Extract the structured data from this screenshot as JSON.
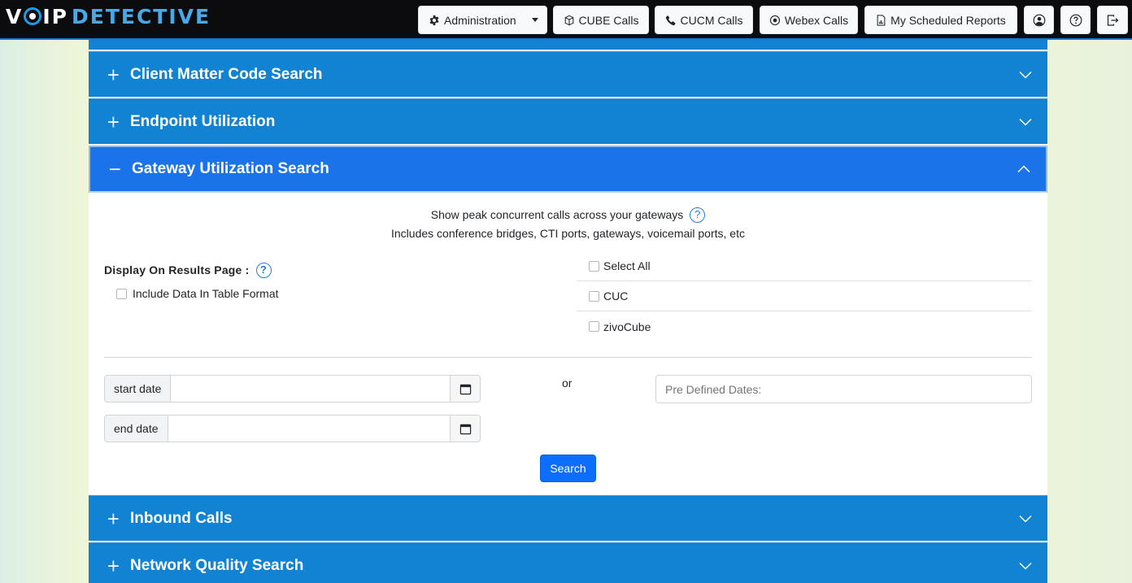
{
  "brand": {
    "part1": "V",
    "part2": "IP",
    "part3": "DETECTIVE"
  },
  "nav": {
    "administration": "Administration",
    "cube_calls": "CUBE Calls",
    "cucm_calls": "CUCM Calls",
    "webex_calls": "Webex Calls",
    "scheduled_reports": "My Scheduled Reports"
  },
  "accordion": {
    "items": [
      {
        "sign": "+",
        "title": "Client Matter Code Search"
      },
      {
        "sign": "+",
        "title": "Endpoint Utilization"
      },
      {
        "sign": "−",
        "title": "Gateway Utilization Search"
      },
      {
        "sign": "+",
        "title": "Inbound Calls"
      },
      {
        "sign": "+",
        "title": "Network Quality Search"
      }
    ]
  },
  "panel": {
    "description_1": "Show peak concurrent calls across your gateways",
    "description_2": "Includes conference bridges, CTI ports, gateways, voicemail ports, etc",
    "help_glyph": "?",
    "display_label": "Display On Results Page :",
    "table_format_label": "Include Data In Table Format",
    "gateways": [
      "Select All",
      "CUC",
      "zivoCube"
    ],
    "start_date_label": "start date",
    "start_date_value": "",
    "end_date_label": "end date",
    "end_date_value": "",
    "or_text": "or",
    "predefined_dates": "Pre Defined Dates:",
    "search_button": "Search"
  },
  "colors": {
    "accordion_header": "#1282d2",
    "accordion_active": "#1a73e8",
    "primary_button": "#0d6efd",
    "navbar": "#0c0c0e"
  }
}
